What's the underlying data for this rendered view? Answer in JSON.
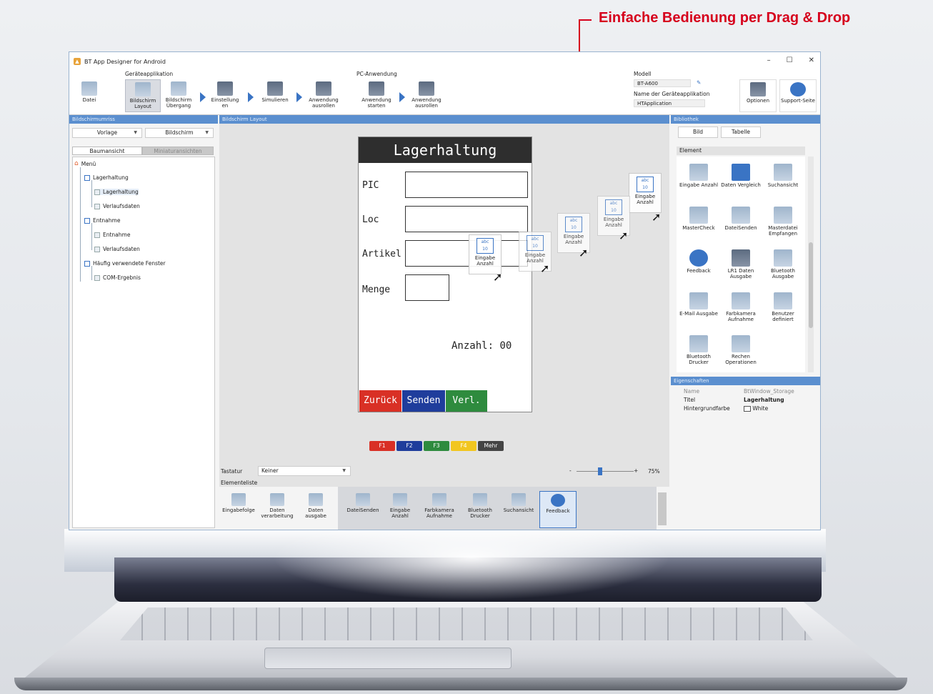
{
  "callout": {
    "text": "Einfache Bedienung per Drag & Drop"
  },
  "window": {
    "title": "BT App Designer for Android",
    "controls": [
      "–",
      "☐",
      "✕"
    ]
  },
  "ribbon": {
    "groups": {
      "device_app": "Geräteapplikation",
      "pc_app": "PC-Anwendung",
      "model": "Modell"
    },
    "buttons": {
      "file": "Datei",
      "screen_layout": "Bildschirm Layout",
      "screen_transition": "Bildschirm Übergang",
      "settings": "Einstellung en",
      "simulate": "Simulieren",
      "distribute_app": "Anwendung ausrollen",
      "start_app": "Anwendung starten",
      "distribute_app_pc": "Anwendung ausrollen",
      "options": "Optionen",
      "support": "Support-Seite"
    },
    "model_value": "BT-A600",
    "app_name_label": "Name der Geräteapplikation",
    "app_name_value": "HTApplication"
  },
  "panels": {
    "outline": "Bildschirmumriss",
    "layout": "Bildschirm Layout",
    "library": "Bibliothek",
    "properties": "Eigenschaften"
  },
  "left": {
    "template_dd": "Vorlage",
    "screen_dd": "Bildschirm",
    "tab_tree": "Baumansicht",
    "tab_thumbs": "Miniaturansichten",
    "tree": {
      "menu": "Menü",
      "storage": "Lagerhaltung",
      "storage_child": "Lagerhaltung",
      "history1": "Verlaufsdaten",
      "withdraw": "Entnahme",
      "withdraw_child": "Entnahme",
      "history2": "Verlaufsdaten",
      "frequent": "Häufig verwendete Fenster",
      "com_result": "COM-Ergebnis"
    }
  },
  "device": {
    "title": "Lagerhaltung",
    "labels": [
      "PIC",
      "Loc",
      "Artikel",
      "Menge"
    ],
    "count_label": "Anzahl:",
    "count_value": "00",
    "buttons": [
      "Zurück",
      "Senden",
      "Verl."
    ]
  },
  "fkeys": [
    "F1",
    "F2",
    "F3",
    "F4",
    "Mehr"
  ],
  "keyboard": {
    "label": "Tastatur",
    "value": "Keiner",
    "zoom": "75%",
    "minus": "-",
    "plus": "+"
  },
  "element_list": {
    "label": "Elementeliste",
    "items": [
      "Eingabefolge",
      "Daten verarbeitung",
      "Daten ausgabe",
      "DateiSenden",
      "Eingabe Anzahl",
      "Farbkamera Aufnahme",
      "Bluetooth Drucker",
      "Suchansicht",
      "Feedback"
    ]
  },
  "library": {
    "tab_image": "Bild",
    "tab_table": "Tabelle",
    "section": "Element",
    "items": [
      "Eingabe Anzahl",
      "Daten Vergleich",
      "Suchansicht",
      "MasterCheck",
      "DateiSenden",
      "Masterdatei Empfangen",
      "Feedback",
      "LR1 Daten Ausgabe",
      "Bluetooth Ausgabe",
      "E-Mail Ausgabe",
      "Farbkamera Aufnahme",
      "Benutzer definiert",
      "Bluetooth Drucker",
      "Rechen Operationen"
    ]
  },
  "properties": {
    "rows": [
      {
        "key": "Name",
        "value": "BtWindow_Storage"
      },
      {
        "key": "Titel",
        "value": "Lagerhaltung"
      },
      {
        "key": "Hintergrundfarbe",
        "value": "White"
      }
    ]
  },
  "ghost": {
    "abc": "abc",
    "num": "10",
    "label": "Eingabe Anzahl"
  },
  "colors": {
    "accent": "#5b8fcf",
    "callout": "#d6001c",
    "f1": "#d93025",
    "f2": "#1f3d9c",
    "f3": "#2e8b3e",
    "f4": "#f2c61f",
    "more": "#444444"
  }
}
